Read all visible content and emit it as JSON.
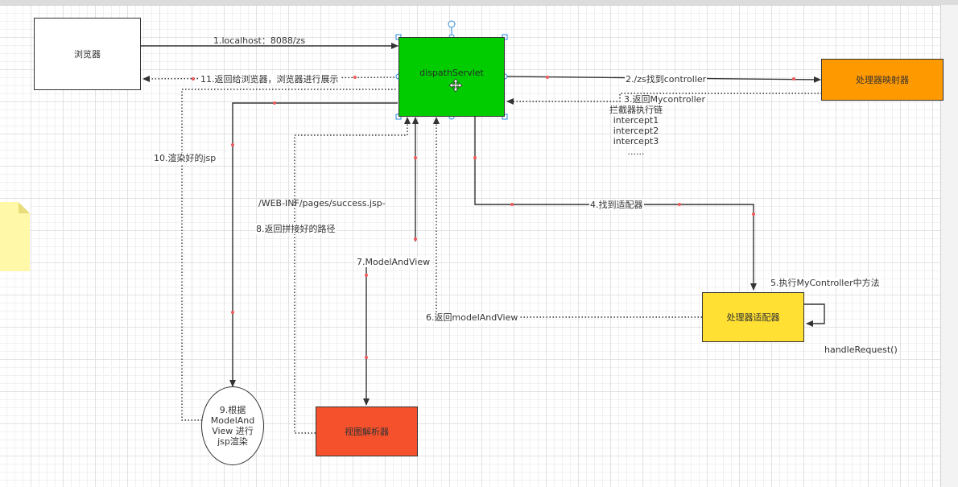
{
  "nodes": {
    "browser": "浏览器",
    "dispatcher": "dispathServlet",
    "mapper": "处理器映射器",
    "adapter": "处理器适配器",
    "view_resolver": "视图解析器",
    "render": "9.根据\nModelAnd\nView 进行\njsp渲染"
  },
  "labels": {
    "step1": "1.localhost：8088/zs",
    "step11": "11.返回给浏览器，浏览器进行展示",
    "step2": "2./zs找到controller",
    "step3": "3.返回Mycontroller",
    "step3_chain": [
      "拦截器执行链",
      "intercept1",
      "intercept2",
      "intercept3",
      "......"
    ],
    "step10": "10.渲染好的jsp",
    "path": "/WEB-INF/pages/success.jsp-",
    "step8": "8.返回拼接好的路径",
    "step4": "4.找到适配器",
    "step7": "7.ModelAndView",
    "step5": "5.执行MyController中方法",
    "step6": "6.返回modelAndView",
    "handle": "handleRequest()"
  },
  "colors": {
    "dispatcher": "#00cc00",
    "mapper": "#ff9900",
    "adapter": "#ffe033",
    "view_resolver": "#f4512c",
    "note": "#fff8a8",
    "selection": "#2b8ad8"
  },
  "icons": {
    "move": "move-cursor-icon"
  }
}
